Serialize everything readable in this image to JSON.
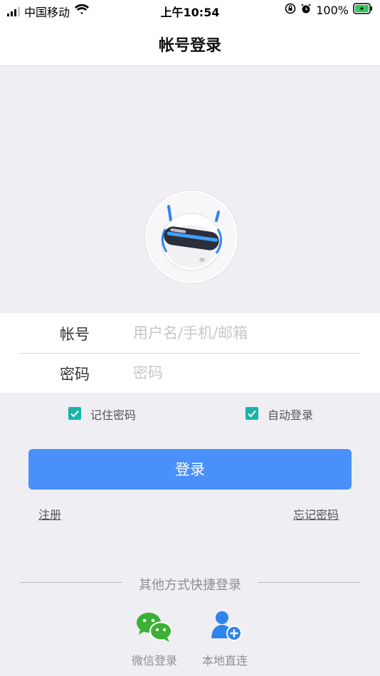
{
  "status": {
    "carrier": "中国移动",
    "time": "上午10:54",
    "battery": "100%"
  },
  "nav": {
    "title": "帐号登录"
  },
  "form": {
    "account_label": "帐号",
    "account_placeholder": "用户名/手机/邮箱",
    "password_label": "密码",
    "password_placeholder": "密码"
  },
  "options": {
    "remember_label": "记住密码",
    "auto_login_label": "自动登录"
  },
  "actions": {
    "login_label": "登录",
    "register_label": "注册",
    "forgot_label": "忘记密码"
  },
  "alt_login": {
    "title": "其他方式快捷登录",
    "items": [
      {
        "label": "微信登录",
        "icon": "wechat-icon"
      },
      {
        "label": "本地直连",
        "icon": "add-user-icon"
      }
    ]
  },
  "colors": {
    "primary": "#4a90fa",
    "checkbox": "#19b3a7",
    "wechat": "#3cb035",
    "user_blue": "#2f84ec"
  }
}
